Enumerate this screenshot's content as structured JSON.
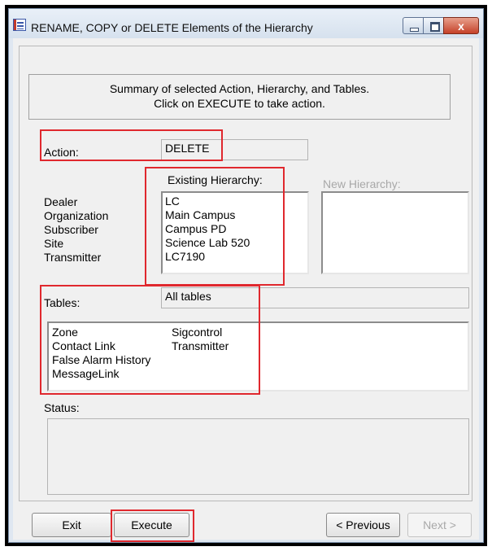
{
  "window": {
    "title": "RENAME, COPY or DELETE Elements of the Hierarchy",
    "minimize_icon": "minimize-icon",
    "maximize_icon": "maximize-icon",
    "close_label": "x"
  },
  "summary": {
    "line1": "Summary of selected Action, Hierarchy, and Tables.",
    "line2": "Click on EXECUTE to take action."
  },
  "action": {
    "label": "Action:",
    "value": "DELETE"
  },
  "hierarchy": {
    "existing_header": "Existing Hierarchy:",
    "new_header": "New Hierarchy:",
    "levels": [
      {
        "name": "Dealer",
        "existing": "LC"
      },
      {
        "name": "Organization",
        "existing": "Main Campus"
      },
      {
        "name": "Subscriber",
        "existing": "Campus PD"
      },
      {
        "name": "Site",
        "existing": "Science Lab 520"
      },
      {
        "name": "Transmitter",
        "existing": "LC7190"
      }
    ]
  },
  "tables": {
    "label": "Tables:",
    "value": "All tables",
    "column1": [
      "Zone",
      "Contact Link",
      "False Alarm History",
      "MessageLink"
    ],
    "column2": [
      "Sigcontrol",
      "Transmitter"
    ]
  },
  "status": {
    "label": "Status:",
    "text": ""
  },
  "buttons": {
    "exit": "Exit",
    "execute": "Execute",
    "previous": "< Previous",
    "next": "Next >"
  },
  "colors": {
    "highlight": "#e0282e",
    "dialog_bg": "#f0f0f0",
    "titlebar": "#dfe7f1"
  }
}
